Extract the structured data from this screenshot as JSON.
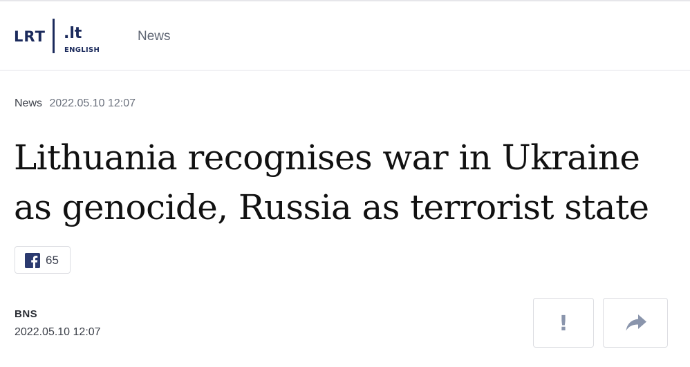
{
  "header": {
    "logo": {
      "brand": "LRT",
      "domain": ".lt",
      "language": "ENGLISH"
    },
    "nav": {
      "news_label": "News"
    }
  },
  "article": {
    "category": "News",
    "date_top": "2022.05.10 12:07",
    "title": "Lithuania recognises war in Ukraine as genocide, Russia as terrorist state",
    "facebook_count": "65",
    "author": "BNS",
    "date_bottom": "2022.05.10 12:07"
  },
  "actions": {
    "report_icon": "exclamation-icon",
    "share_icon": "share-arrow-icon"
  },
  "colors": {
    "brand": "#1b2a5c",
    "facebook": "#2b3a6f",
    "icon_gray": "#8a95ac",
    "border": "#dcdde2"
  }
}
